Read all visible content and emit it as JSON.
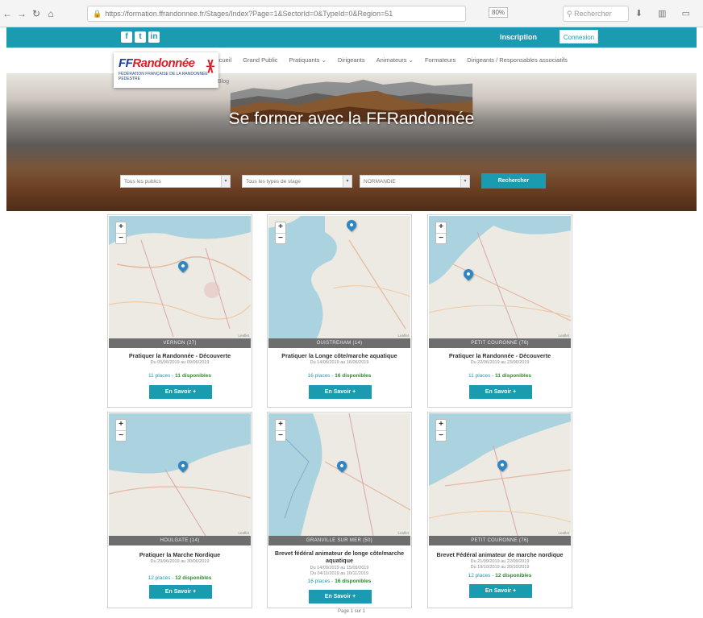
{
  "browser": {
    "url": "https://formation.ffrandonnee.fr/Stages/Index?Page=1&SectorId=0&TypeId=0&Region=51",
    "zoom": "80%",
    "search_placeholder": "Rechercher"
  },
  "header": {
    "social": [
      "f",
      "t",
      "in"
    ],
    "inscription": "Inscription",
    "connexion": "Connexion"
  },
  "logo": {
    "brand": "Randonnée",
    "brand_prefix": "FF",
    "tagline": "FÉDÉRATION FRANÇAISE DE LA RANDONNÉE PÉDESTRE"
  },
  "nav": {
    "items": [
      "Accueil",
      "Grand Public",
      "Pratiquants ⌄",
      "Dirigeants",
      "Animateurs ⌄",
      "Formateurs",
      "Dirigeants / Responsables associatifs"
    ],
    "blog": "Blog"
  },
  "hero": {
    "title": "Se former avec la FFRandonnée",
    "filter_public": "Tous les publics",
    "filter_type": "Tous les types de stage",
    "filter_region": "NORMANDIE",
    "search_button": "Rechercher"
  },
  "cards": [
    {
      "location": "VERNON (27)",
      "title": "Pratiquer la Randonnée - Découverte",
      "dates": [
        "Du 05/06/2019 au 09/06/2019"
      ],
      "places": "11 places",
      "available": "11 disponibles",
      "button": "En Savoir +"
    },
    {
      "location": "OUISTREHAM (14)",
      "title": "Pratiquer la Longe côte/marche aquatique",
      "dates": [
        "Du 14/06/2019 au 16/06/2019"
      ],
      "places": "16 places",
      "available": "16 disponibles",
      "button": "En Savoir +"
    },
    {
      "location": "PETIT COURONNE (76)",
      "title": "Pratiquer la Randonnée - Découverte",
      "dates": [
        "Du 22/06/2019 au 23/06/2019"
      ],
      "places": "11 places",
      "available": "11 disponibles",
      "button": "En Savoir +"
    },
    {
      "location": "HOULGATE (14)",
      "title": "Pratiquer la Marche Nordique",
      "dates": [
        "Du 29/06/2019 au 30/06/2019"
      ],
      "places": "12 places",
      "available": "12 disponibles",
      "button": "En Savoir +"
    },
    {
      "location": "GRANVILLE SUR MER (50)",
      "title": "Brevet fédéral animateur de longe côte/marche aquatique",
      "dates": [
        "Du 14/09/2019 au 15/09/2019",
        "Du 04/11/2019 au 10/11/2019"
      ],
      "places": "16 places",
      "available": "16 disponibles",
      "button": "En Savoir +"
    },
    {
      "location": "PETIT COURONNE (76)",
      "title": "Brevet Fédéral animateur de marche nordique",
      "dates": [
        "Du 21/09/2019 au 22/09/2019",
        "Du 19/10/2019 au 20/10/2019"
      ],
      "places": "12 places",
      "available": "12 disponibles",
      "button": "En Savoir +"
    }
  ],
  "map": {
    "attribution": "Leaflet",
    "zoom_in": "+",
    "zoom_out": "−"
  },
  "pager": "Page 1 sur 1"
}
